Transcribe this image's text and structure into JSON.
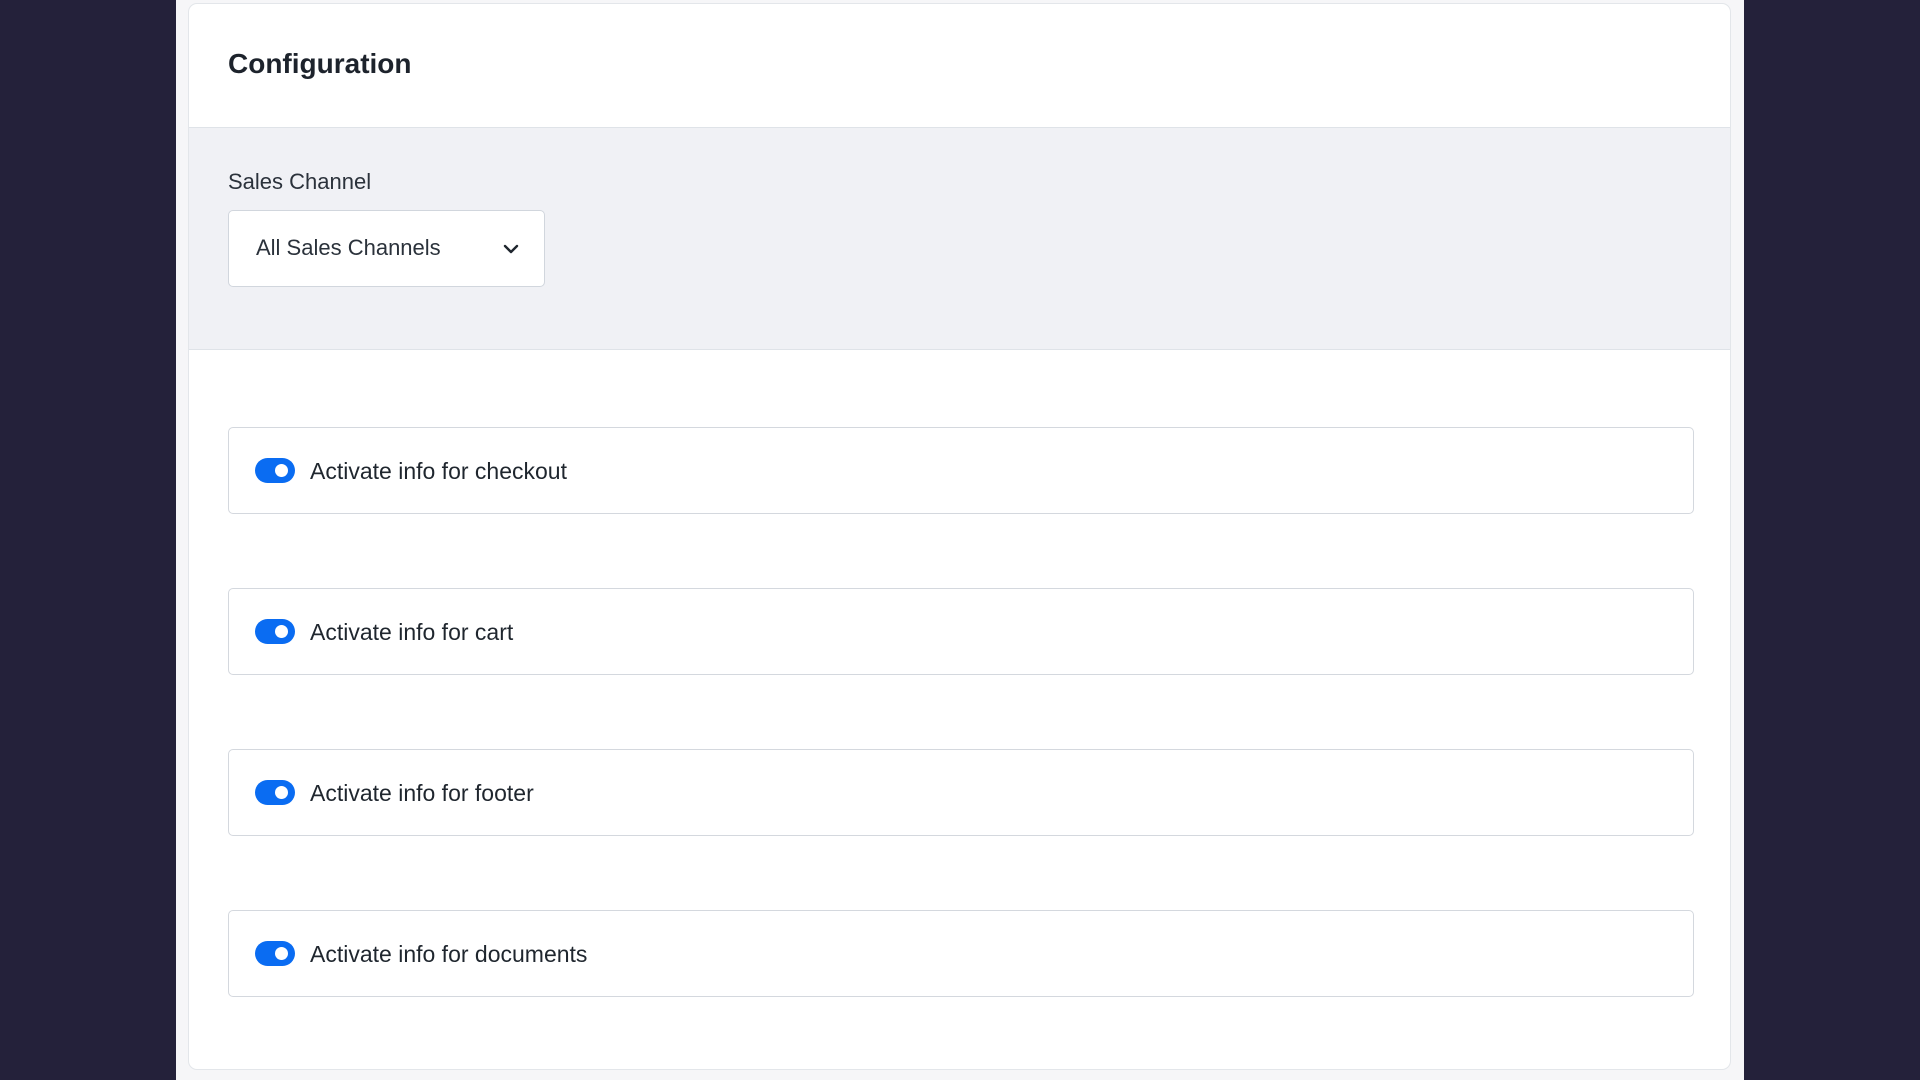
{
  "card": {
    "title": "Configuration"
  },
  "sales_channel": {
    "label": "Sales Channel",
    "selected": "All Sales Channels"
  },
  "toggles": [
    {
      "label": "Activate info for checkout",
      "checked": true
    },
    {
      "label": "Activate info for cart",
      "checked": true
    },
    {
      "label": "Activate info for footer",
      "checked": true
    },
    {
      "label": "Activate info for documents",
      "checked": true
    }
  ],
  "colors": {
    "backdrop": "#24213a",
    "toggle_on": "#0a6cf2",
    "filter_bg": "#f0f1f5"
  },
  "icons": {
    "select_chevron": "chevron-down-icon"
  }
}
